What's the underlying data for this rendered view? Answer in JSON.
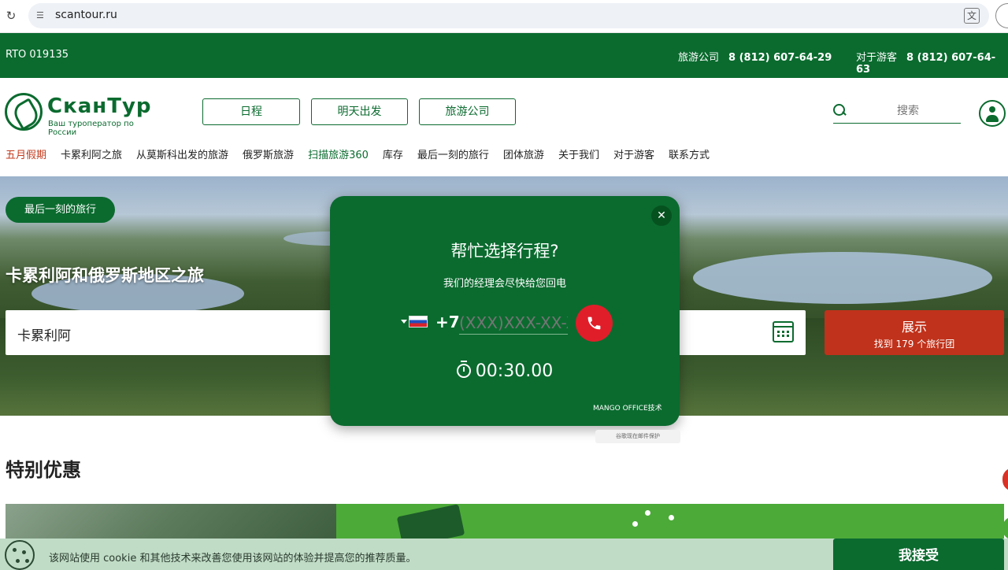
{
  "browser": {
    "url": "scantour.ru"
  },
  "topbar": {
    "rto": "RTO 019135",
    "agencies_label": "旅游公司",
    "agencies_phone": "8 (812) 607-64-29",
    "tourists_label": "对于游客",
    "tourists_phone": "8 (812) 607-64-63"
  },
  "logo": {
    "name": "СканТур",
    "tagline": "Ваш туроператор по России"
  },
  "header_buttons": [
    "日程",
    "明天出发",
    "旅游公司"
  ],
  "search": {
    "placeholder": "搜索"
  },
  "nav": [
    "五月假期",
    "卡累利阿之旅",
    "从莫斯科出发的旅游",
    "俄罗斯旅游",
    "扫描旅游360",
    "库存",
    "最后一刻的旅行",
    "团体旅游",
    "关于我们",
    "对于游客",
    "联系方式"
  ],
  "hero": {
    "badge": "最后一刻的旅行",
    "title": "卡累利阿和俄罗斯地区之旅",
    "destination": "卡累利阿",
    "show_button": {
      "title": "展示",
      "subtitle": "找到 179 个旅行团"
    }
  },
  "special": {
    "title": "特别优惠"
  },
  "cookie": {
    "text": "该网站使用 cookie 和其他技术来改善您使用该网站的体验并提高您的推荐质量。",
    "accept": "我接受"
  },
  "modal": {
    "title": "帮忙选择行程?",
    "subtitle": "我们的经理会尽快给您回电",
    "prefix": "+7",
    "phone_placeholder": "(XXX)XXX-XX-XX",
    "timer": "00:30.00",
    "powered": "MANGO OFFICE技术",
    "protect_note": "谷歌现在邮件保护"
  },
  "colors": {
    "brand": "#0b6b2f",
    "cta": "#c0321b",
    "call": "#e01e2a"
  }
}
